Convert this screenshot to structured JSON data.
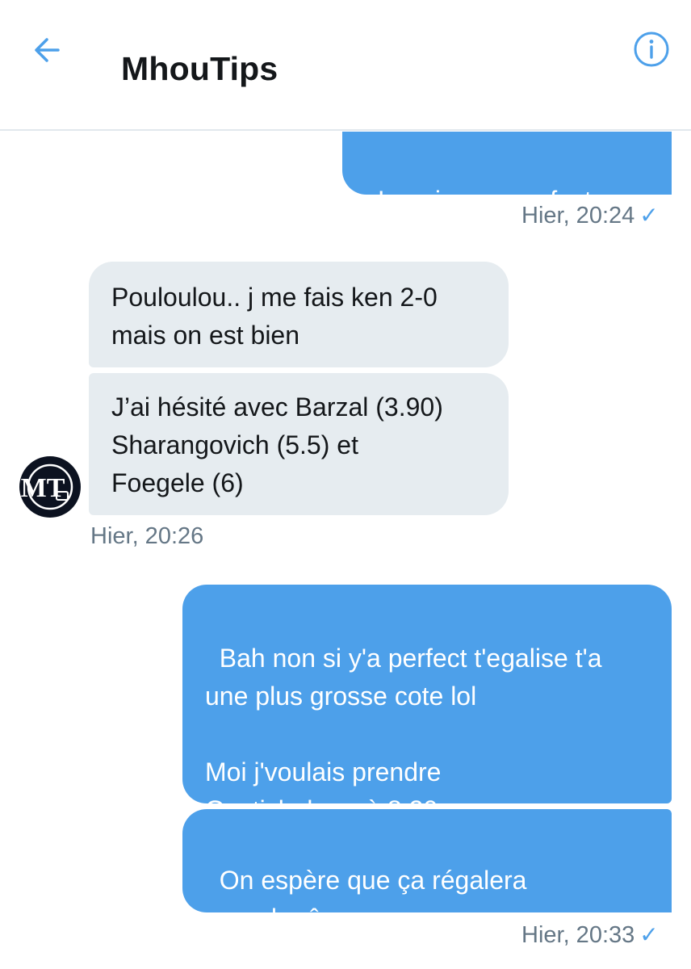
{
  "header": {
    "title": "MhouTips",
    "back_icon": "arrow-left-icon",
    "info_icon": "info-circle-icon",
    "accent": "#4da0ea"
  },
  "colors": {
    "outgoing_bubble": "#4da0ea",
    "incoming_bubble": "#e6ecf0",
    "timestamp": "#657786"
  },
  "messages": [
    {
      "direction": "out",
      "text": "Imagine un perfect",
      "emoji": "😍"
    },
    {
      "direction": "in",
      "text": "Pouloulou.. j me fais ken 2-0\nmais on est bien"
    },
    {
      "direction": "in",
      "text": "J’ai hésité avec Barzal (3.90)\nSharangovich (5.5) et\nFoegele (6)"
    },
    {
      "direction": "out",
      "text": "Bah non si y'a perfect t'egalise t'a\nune plus grosse cote lol\n\nMoi j'voulais prendre\nGostisbehere à 8,20",
      "emoji": "😂"
    },
    {
      "direction": "out",
      "text": "On espère que ça régalera\nquand-même",
      "emoji": "😊"
    }
  ],
  "timestamps": {
    "t1": "Hier, 20:24",
    "t2": "Hier, 20:26",
    "t3": "Hier, 20:33"
  },
  "avatar_text": "MT"
}
